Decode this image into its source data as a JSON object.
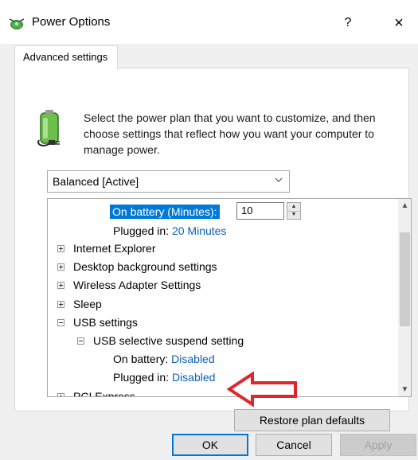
{
  "window": {
    "title": "Power Options",
    "help_label": "?",
    "close_label": "×"
  },
  "tabs": [
    {
      "label": "Advanced settings"
    }
  ],
  "description": "Select the power plan that you want to customize, and then choose settings that reflect how you want your computer to manage power.",
  "plan_select": {
    "value": "Balanced [Active]"
  },
  "settings_tree": {
    "rows": [
      {
        "label": "On battery (Minutes):",
        "spin_value": "10"
      },
      {
        "label": "Plugged in:",
        "value": "20 Minutes"
      },
      {
        "label": "Internet Explorer"
      },
      {
        "label": "Desktop background settings"
      },
      {
        "label": "Wireless Adapter Settings"
      },
      {
        "label": "Sleep"
      },
      {
        "label": "USB settings"
      },
      {
        "label": "USB selective suspend setting"
      },
      {
        "label": "On battery:",
        "value": "Disabled"
      },
      {
        "label": "Plugged in:",
        "value": "Disabled"
      },
      {
        "label": "PCI Express"
      }
    ]
  },
  "buttons": {
    "restore": "Restore plan defaults",
    "ok": "OK",
    "cancel": "Cancel",
    "apply": "Apply"
  },
  "colors": {
    "accent": "#0078d7",
    "link": "#0a5fbd",
    "annotation_arrow": "#e0262b"
  },
  "icons": {
    "window": "power-options-icon",
    "plan": "battery-plug-icon",
    "annotation": "red-arrow-annotation"
  }
}
